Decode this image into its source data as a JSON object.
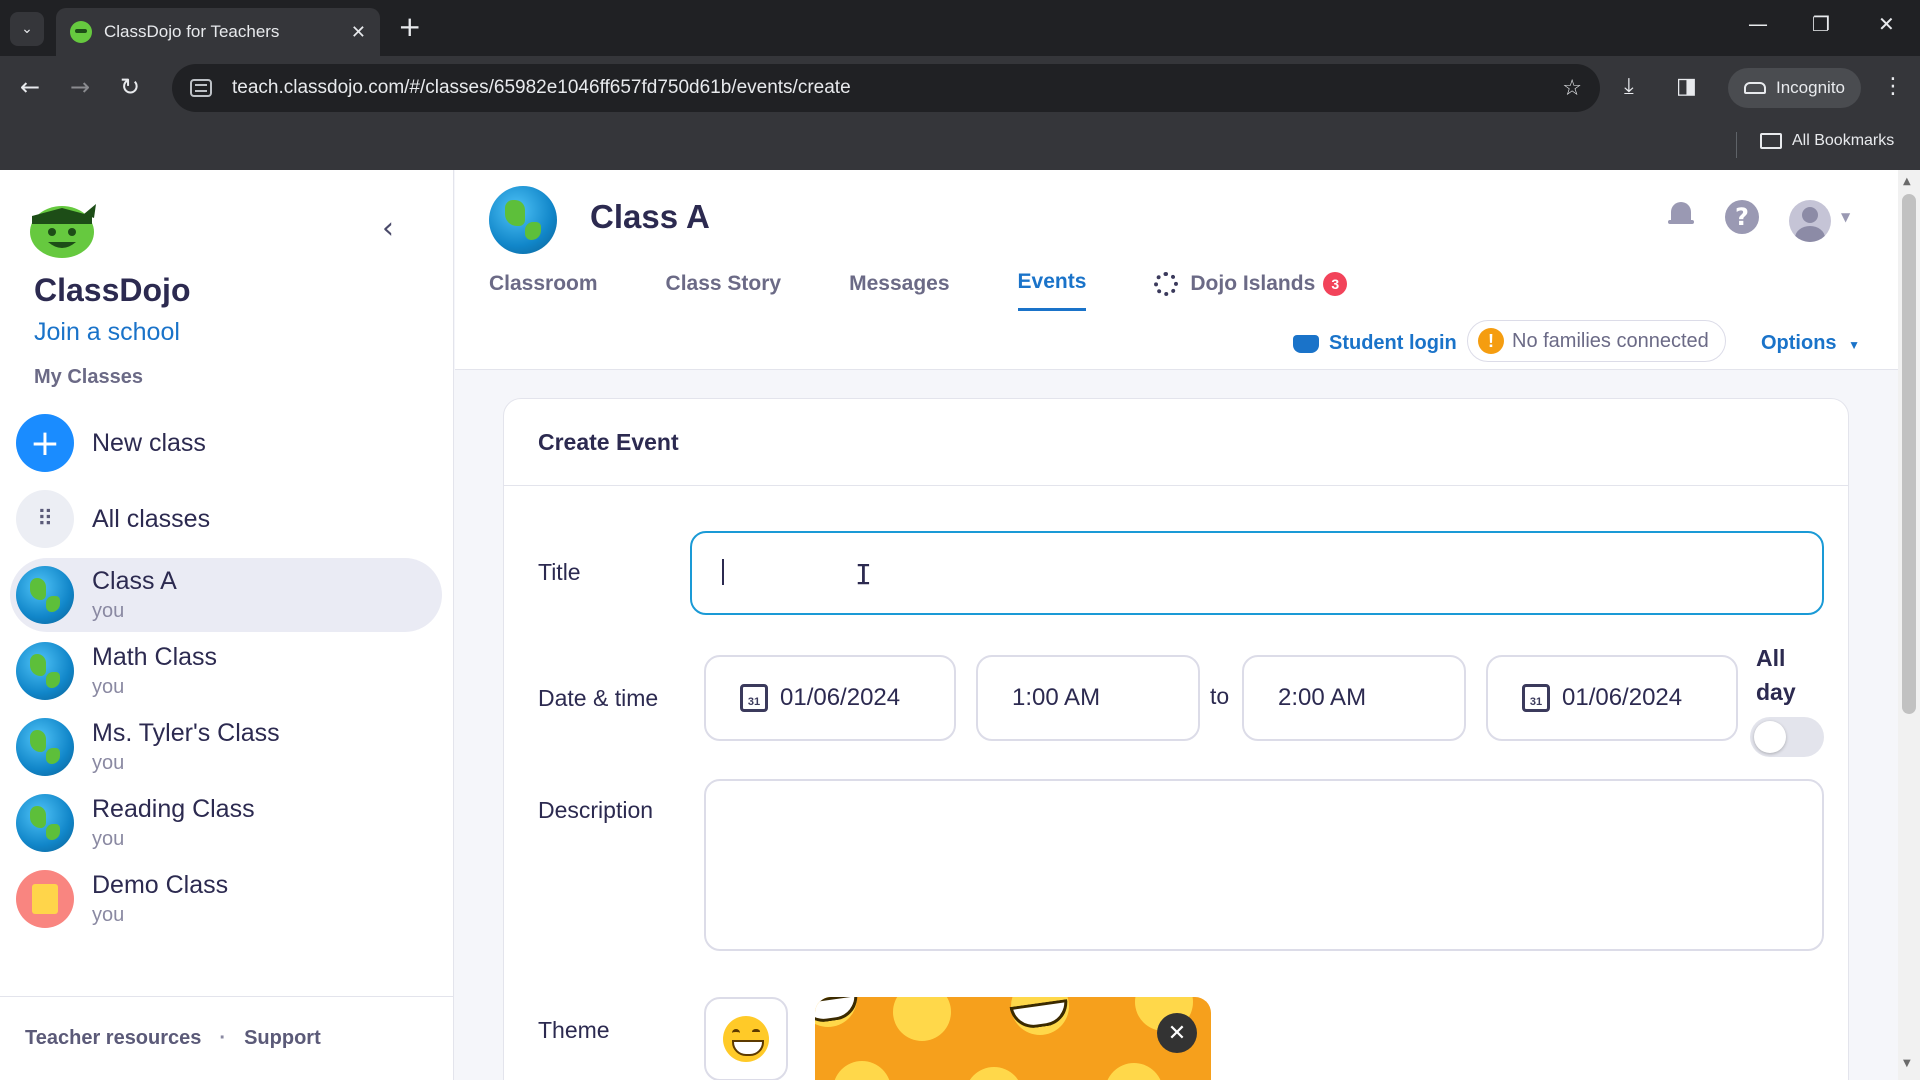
{
  "browser": {
    "tab_title": "ClassDojo for Teachers",
    "url": "teach.classdojo.com/#/classes/65982e1046ff657fd750d61b/events/create",
    "incognito_label": "Incognito",
    "all_bookmarks": "All Bookmarks"
  },
  "sidebar": {
    "brand": "ClassDojo",
    "join_school": "Join a school",
    "my_classes": "My Classes",
    "new_class": "New class",
    "all_classes": "All classes",
    "classes": [
      {
        "name": "Class A",
        "owner": "you"
      },
      {
        "name": "Math Class",
        "owner": "you"
      },
      {
        "name": "Ms. Tyler's Class",
        "owner": "you"
      },
      {
        "name": "Reading Class",
        "owner": "you"
      },
      {
        "name": "Demo Class",
        "owner": "you"
      }
    ],
    "footer": {
      "resources": "Teacher resources",
      "separator": "·",
      "support": "Support"
    }
  },
  "header": {
    "class_name": "Class A",
    "tabs": [
      {
        "label": "Classroom"
      },
      {
        "label": "Class Story"
      },
      {
        "label": "Messages"
      },
      {
        "label": "Events"
      },
      {
        "label": "Dojo Islands",
        "badge": "3"
      }
    ],
    "active_tab": "Events",
    "student_login": "Student login",
    "families_status": "No families connected",
    "options": "Options"
  },
  "event_form": {
    "heading": "Create Event",
    "title_label": "Title",
    "title_value": "",
    "datetime_label": "Date & time",
    "start_date": "01/06/2024",
    "start_time": "1:00 AM",
    "to_label": "to",
    "end_time": "2:00 AM",
    "end_date": "01/06/2024",
    "calendar_day": "31",
    "all_day_label": "All day",
    "all_day_on": false,
    "description_label": "Description",
    "description_value": "",
    "theme_label": "Theme"
  },
  "colors": {
    "accent": "#1a73c9",
    "badge": "#f2435a",
    "warning": "#f59d10",
    "theme_preview": "#f6a01c"
  }
}
